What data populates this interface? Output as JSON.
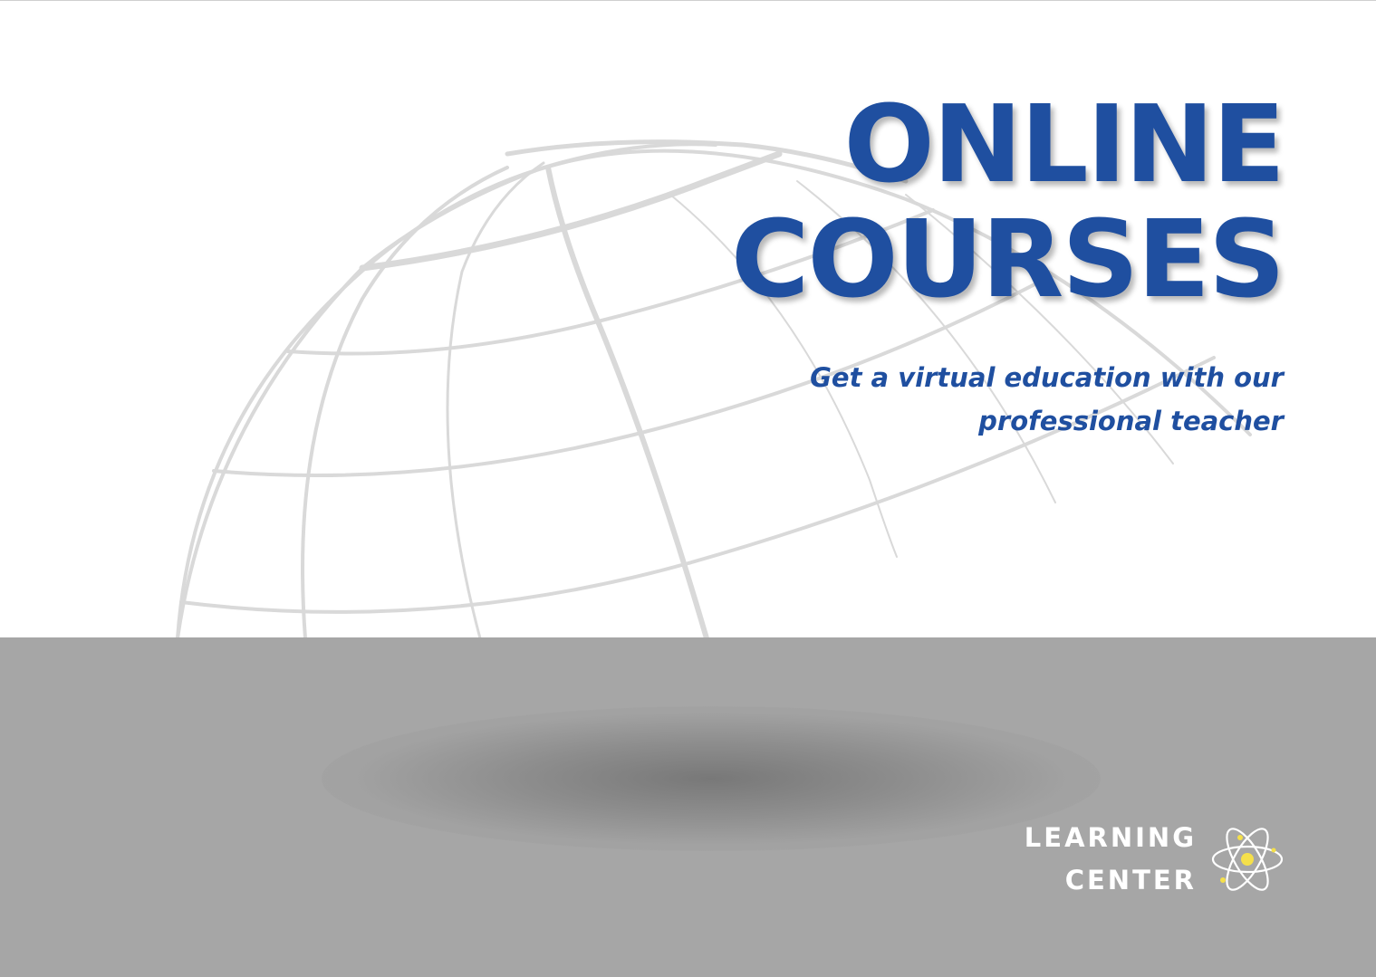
{
  "headline": {
    "line1": "ONLINE",
    "line2": "COURSES"
  },
  "tagline": {
    "line1": "Get a virtual education with our",
    "line2": "professional teacher"
  },
  "brand": {
    "line1": "LEARNING",
    "line2": "CENTER",
    "logo_icon": "atom-icon"
  },
  "colors": {
    "headline": "#1f4fa0",
    "floor": "#a6a6a6",
    "globe_lines": "#d9d9d9",
    "logo_accent": "#f5e04a",
    "brand_text": "#ffffff"
  }
}
